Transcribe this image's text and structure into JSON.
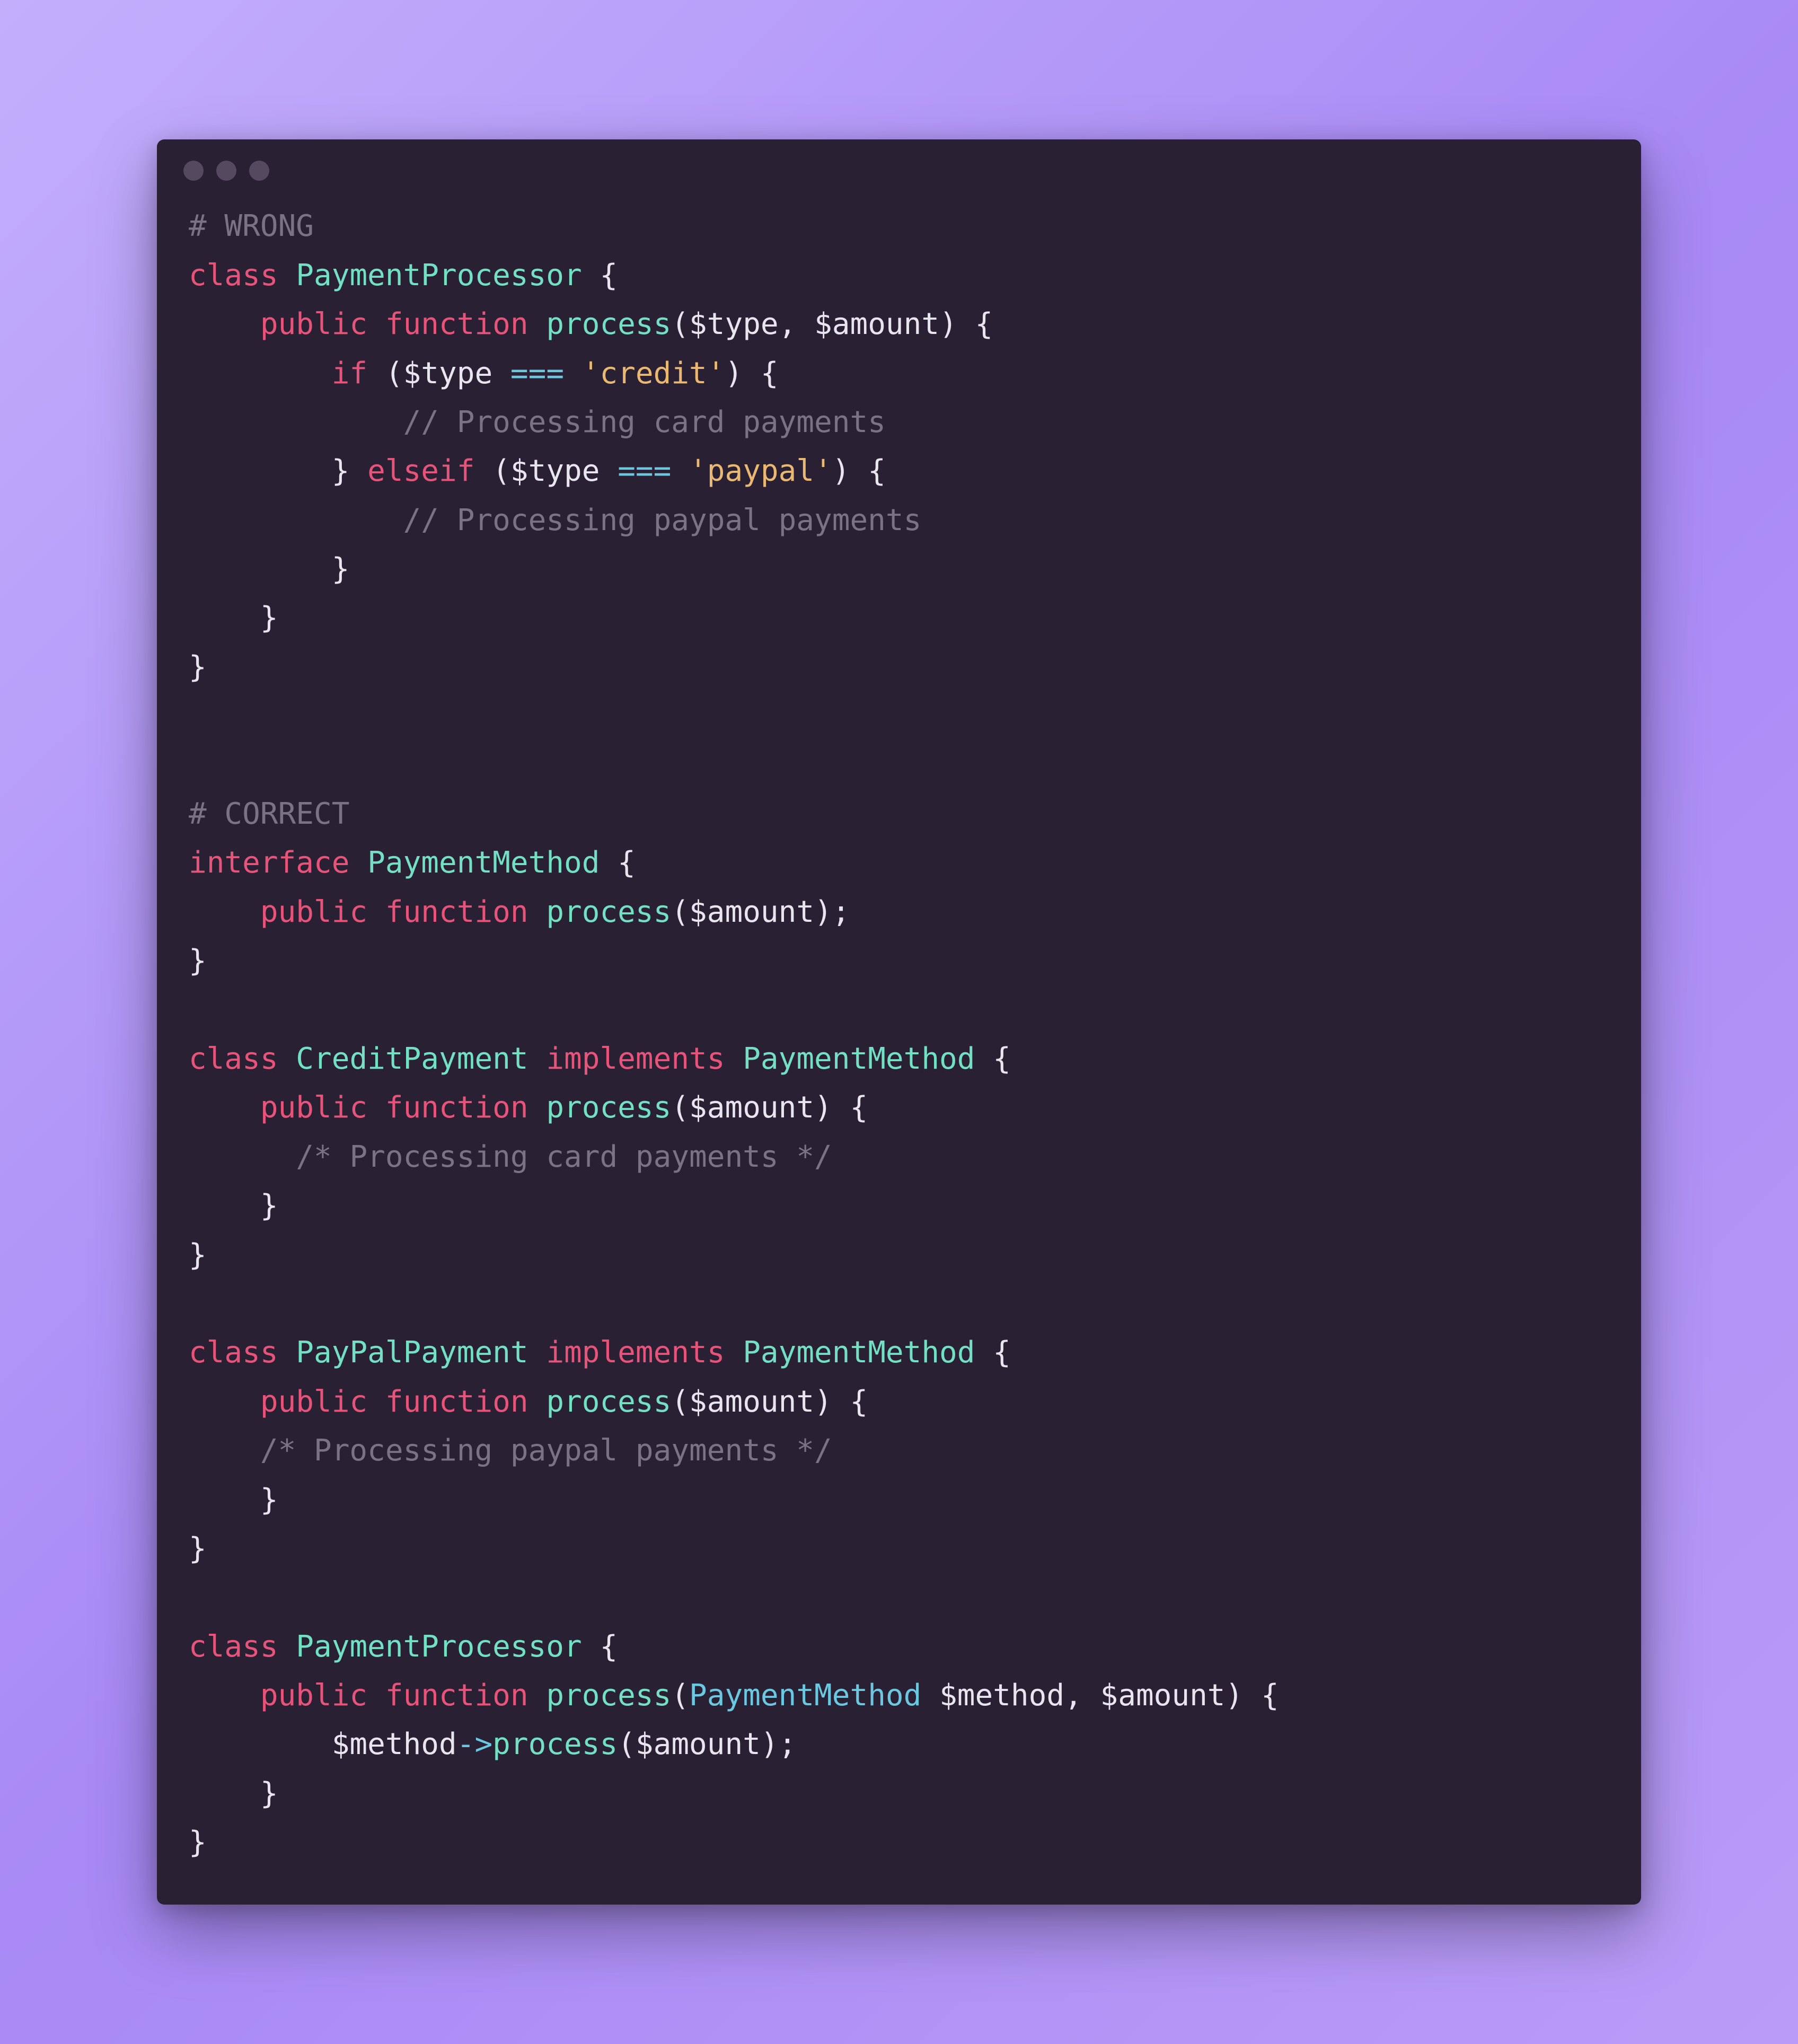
{
  "code": {
    "lines": [
      [
        {
          "cls": "c-comment",
          "t": "# WRONG"
        }
      ],
      [
        {
          "cls": "c-keyword",
          "t": "class"
        },
        {
          "cls": "c-punct",
          "t": " "
        },
        {
          "cls": "c-type",
          "t": "PaymentProcessor"
        },
        {
          "cls": "c-punct",
          "t": " {"
        }
      ],
      [
        {
          "cls": "c-punct",
          "t": "    "
        },
        {
          "cls": "c-keyword",
          "t": "public"
        },
        {
          "cls": "c-punct",
          "t": " "
        },
        {
          "cls": "c-keyword",
          "t": "function"
        },
        {
          "cls": "c-punct",
          "t": " "
        },
        {
          "cls": "c-func",
          "t": "process"
        },
        {
          "cls": "c-punct",
          "t": "("
        },
        {
          "cls": "c-var",
          "t": "$type"
        },
        {
          "cls": "c-punct",
          "t": ", "
        },
        {
          "cls": "c-var",
          "t": "$amount"
        },
        {
          "cls": "c-punct",
          "t": ") {"
        }
      ],
      [
        {
          "cls": "c-punct",
          "t": "        "
        },
        {
          "cls": "c-keyword",
          "t": "if"
        },
        {
          "cls": "c-punct",
          "t": " ("
        },
        {
          "cls": "c-var",
          "t": "$type"
        },
        {
          "cls": "c-punct",
          "t": " "
        },
        {
          "cls": "c-op",
          "t": "==="
        },
        {
          "cls": "c-punct",
          "t": " "
        },
        {
          "cls": "c-string",
          "t": "'credit'"
        },
        {
          "cls": "c-punct",
          "t": ") {"
        }
      ],
      [
        {
          "cls": "c-punct",
          "t": "            "
        },
        {
          "cls": "c-comment",
          "t": "// Processing card payments"
        }
      ],
      [
        {
          "cls": "c-punct",
          "t": "        } "
        },
        {
          "cls": "c-keyword",
          "t": "elseif"
        },
        {
          "cls": "c-punct",
          "t": " ("
        },
        {
          "cls": "c-var",
          "t": "$type"
        },
        {
          "cls": "c-punct",
          "t": " "
        },
        {
          "cls": "c-op",
          "t": "==="
        },
        {
          "cls": "c-punct",
          "t": " "
        },
        {
          "cls": "c-string",
          "t": "'paypal'"
        },
        {
          "cls": "c-punct",
          "t": ") {"
        }
      ],
      [
        {
          "cls": "c-punct",
          "t": "            "
        },
        {
          "cls": "c-comment",
          "t": "// Processing paypal payments"
        }
      ],
      [
        {
          "cls": "c-punct",
          "t": "        }"
        }
      ],
      [
        {
          "cls": "c-punct",
          "t": "    }"
        }
      ],
      [
        {
          "cls": "c-punct",
          "t": "}"
        }
      ],
      [
        {
          "cls": "c-punct",
          "t": ""
        }
      ],
      [
        {
          "cls": "c-punct",
          "t": ""
        }
      ],
      [
        {
          "cls": "c-comment",
          "t": "# CORRECT"
        }
      ],
      [
        {
          "cls": "c-keyword",
          "t": "interface"
        },
        {
          "cls": "c-punct",
          "t": " "
        },
        {
          "cls": "c-type",
          "t": "PaymentMethod"
        },
        {
          "cls": "c-punct",
          "t": " {"
        }
      ],
      [
        {
          "cls": "c-punct",
          "t": "    "
        },
        {
          "cls": "c-keyword",
          "t": "public"
        },
        {
          "cls": "c-punct",
          "t": " "
        },
        {
          "cls": "c-keyword",
          "t": "function"
        },
        {
          "cls": "c-punct",
          "t": " "
        },
        {
          "cls": "c-func",
          "t": "process"
        },
        {
          "cls": "c-punct",
          "t": "("
        },
        {
          "cls": "c-var",
          "t": "$amount"
        },
        {
          "cls": "c-punct",
          "t": ");"
        }
      ],
      [
        {
          "cls": "c-punct",
          "t": "}"
        }
      ],
      [
        {
          "cls": "c-punct",
          "t": ""
        }
      ],
      [
        {
          "cls": "c-keyword",
          "t": "class"
        },
        {
          "cls": "c-punct",
          "t": " "
        },
        {
          "cls": "c-type",
          "t": "CreditPayment"
        },
        {
          "cls": "c-punct",
          "t": " "
        },
        {
          "cls": "c-keyword",
          "t": "implements"
        },
        {
          "cls": "c-punct",
          "t": " "
        },
        {
          "cls": "c-type",
          "t": "PaymentMethod"
        },
        {
          "cls": "c-punct",
          "t": " {"
        }
      ],
      [
        {
          "cls": "c-punct",
          "t": "    "
        },
        {
          "cls": "c-keyword",
          "t": "public"
        },
        {
          "cls": "c-punct",
          "t": " "
        },
        {
          "cls": "c-keyword",
          "t": "function"
        },
        {
          "cls": "c-punct",
          "t": " "
        },
        {
          "cls": "c-func",
          "t": "process"
        },
        {
          "cls": "c-punct",
          "t": "("
        },
        {
          "cls": "c-var",
          "t": "$amount"
        },
        {
          "cls": "c-punct",
          "t": ") {"
        }
      ],
      [
        {
          "cls": "c-punct",
          "t": "      "
        },
        {
          "cls": "c-comment",
          "t": "/* Processing card payments */"
        }
      ],
      [
        {
          "cls": "c-punct",
          "t": "    }"
        }
      ],
      [
        {
          "cls": "c-punct",
          "t": "}"
        }
      ],
      [
        {
          "cls": "c-punct",
          "t": ""
        }
      ],
      [
        {
          "cls": "c-keyword",
          "t": "class"
        },
        {
          "cls": "c-punct",
          "t": " "
        },
        {
          "cls": "c-type",
          "t": "PayPalPayment"
        },
        {
          "cls": "c-punct",
          "t": " "
        },
        {
          "cls": "c-keyword",
          "t": "implements"
        },
        {
          "cls": "c-punct",
          "t": " "
        },
        {
          "cls": "c-type",
          "t": "PaymentMethod"
        },
        {
          "cls": "c-punct",
          "t": " {"
        }
      ],
      [
        {
          "cls": "c-punct",
          "t": "    "
        },
        {
          "cls": "c-keyword",
          "t": "public"
        },
        {
          "cls": "c-punct",
          "t": " "
        },
        {
          "cls": "c-keyword",
          "t": "function"
        },
        {
          "cls": "c-punct",
          "t": " "
        },
        {
          "cls": "c-func",
          "t": "process"
        },
        {
          "cls": "c-punct",
          "t": "("
        },
        {
          "cls": "c-var",
          "t": "$amount"
        },
        {
          "cls": "c-punct",
          "t": ") {"
        }
      ],
      [
        {
          "cls": "c-punct",
          "t": "    "
        },
        {
          "cls": "c-comment",
          "t": "/* Processing paypal payments */"
        }
      ],
      [
        {
          "cls": "c-punct",
          "t": "    }"
        }
      ],
      [
        {
          "cls": "c-punct",
          "t": "}"
        }
      ],
      [
        {
          "cls": "c-punct",
          "t": ""
        }
      ],
      [
        {
          "cls": "c-keyword",
          "t": "class"
        },
        {
          "cls": "c-punct",
          "t": " "
        },
        {
          "cls": "c-type",
          "t": "PaymentProcessor"
        },
        {
          "cls": "c-punct",
          "t": " {"
        }
      ],
      [
        {
          "cls": "c-punct",
          "t": "    "
        },
        {
          "cls": "c-keyword",
          "t": "public"
        },
        {
          "cls": "c-punct",
          "t": " "
        },
        {
          "cls": "c-keyword",
          "t": "function"
        },
        {
          "cls": "c-punct",
          "t": " "
        },
        {
          "cls": "c-func",
          "t": "process"
        },
        {
          "cls": "c-punct",
          "t": "("
        },
        {
          "cls": "c-typehint",
          "t": "PaymentMethod"
        },
        {
          "cls": "c-punct",
          "t": " "
        },
        {
          "cls": "c-var",
          "t": "$method"
        },
        {
          "cls": "c-punct",
          "t": ", "
        },
        {
          "cls": "c-var",
          "t": "$amount"
        },
        {
          "cls": "c-punct",
          "t": ") {"
        }
      ],
      [
        {
          "cls": "c-punct",
          "t": "        "
        },
        {
          "cls": "c-var",
          "t": "$method"
        },
        {
          "cls": "c-op",
          "t": "->"
        },
        {
          "cls": "c-func",
          "t": "process"
        },
        {
          "cls": "c-punct",
          "t": "("
        },
        {
          "cls": "c-var",
          "t": "$amount"
        },
        {
          "cls": "c-punct",
          "t": ");"
        }
      ],
      [
        {
          "cls": "c-punct",
          "t": "    }"
        }
      ],
      [
        {
          "cls": "c-punct",
          "t": "}"
        }
      ]
    ]
  }
}
